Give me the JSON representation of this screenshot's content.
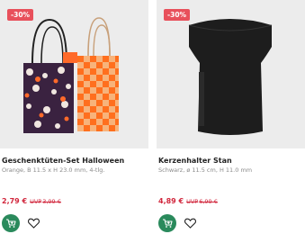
{
  "products": [
    {
      "badge": "-30%",
      "title": "Geschenktüten-Set Halloween",
      "subtitle": "Orange, B 11.5 x H 23.0 mm, 4-tlg.",
      "price": "2,79 €",
      "old_prefix": "UVP",
      "old_price": "3,99 €",
      "cart_icon": "cart-plus-icon",
      "fav_icon": "heart-icon"
    },
    {
      "badge": "-30%",
      "title": "Kerzenhalter Stan",
      "subtitle": "Schwarz, ø 11.5 cm, H 11.0 mm",
      "price": "4,89 €",
      "old_prefix": "UVP",
      "old_price": "6,99 €",
      "cart_icon": "cart-plus-icon",
      "fav_icon": "heart-icon"
    }
  ],
  "colors": {
    "badge": "#e8505b",
    "price": "#d1263c",
    "cart": "#2a8a5c"
  }
}
